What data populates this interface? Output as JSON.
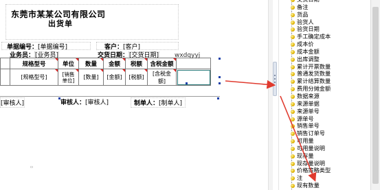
{
  "report": {
    "title": "东莞市某某公司有限公司",
    "subtitle": "出货单"
  },
  "header_fields": {
    "bill_no_label": "单据编号：",
    "bill_no_value": "[单据编号]",
    "customer_label": "客户：",
    "customer_value": "[客户]",
    "salesman_label": "业务员：",
    "salesman_value": "[业务员]",
    "delivery_date_label": "交货日期：",
    "delivery_date_value": "[交货日期]"
  },
  "grid": {
    "headers": [
      "规格型号",
      "单位",
      "数量",
      "金额",
      "税额",
      "含税金额",
      ""
    ],
    "row": [
      "[规格型号]",
      "[销售单位]",
      "[数量]",
      "[金额]",
      "[税额]",
      "[含税金额]",
      ""
    ]
  },
  "floating_text": "wxdqyyj",
  "footer": {
    "f1": "[审核人]",
    "f2_label": "审核人：",
    "f2_value": "[审核人]",
    "f3_label": "制单人：",
    "f3_value": "[制单人]"
  },
  "field_list": [
    "交货日期",
    "备注",
    "货品",
    "验货人",
    "验货日期",
    "手工确定成本",
    "成本价",
    "成本金额",
    "出库调整",
    "累计开票数量",
    "普通发货数量",
    "累计结算数量",
    "费用分摊金额",
    "数据来源",
    "来源单据",
    "来源单号",
    "源单号",
    "销售单号",
    "销售订单号",
    "可用量",
    "可用量说明",
    "现存量",
    "现存量说明",
    "价格策略类型",
    "注",
    "现有数量"
  ],
  "colors": {
    "arrow": "#e03a2e",
    "icon": "#e0b400"
  }
}
